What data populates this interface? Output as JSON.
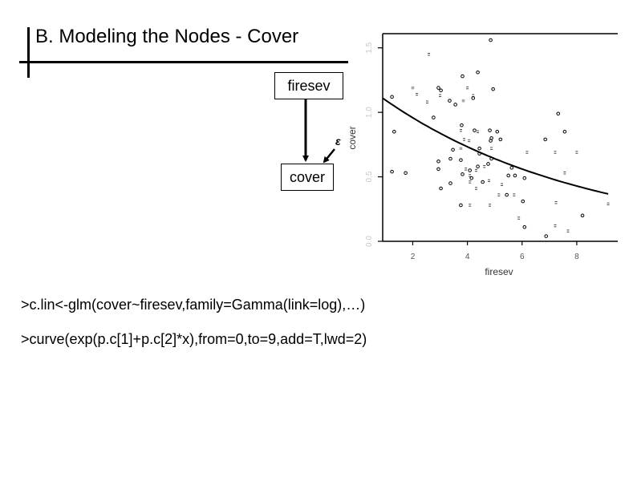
{
  "slide": {
    "title": "B. Modeling the Nodes - Cover",
    "diagram": {
      "parent_node": "firesev",
      "child_node": "cover",
      "error_label": "ε"
    },
    "code_lines": [
      ">c.lin<-glm(cover~firesev,family=Gamma(link=log),…)",
      ">curve(exp(p.c[1]+p.c[2]*x),from=0,to=9,add=T,lwd=2)"
    ]
  },
  "chart_data": {
    "type": "scatter",
    "title": "",
    "xlabel": "firesev",
    "ylabel": "cover",
    "xlim": [
      0.9,
      9.5
    ],
    "ylim": [
      0.0,
      1.61
    ],
    "x_ticks": [
      2,
      4,
      6,
      8
    ],
    "x_tick_labels": [
      "2",
      "4",
      "6",
      "8"
    ],
    "y_ticks": [
      0.0,
      0.5,
      1.0,
      1.5
    ],
    "y_tick_labels": [
      "0.0",
      "0.5",
      "1.0",
      "1.5"
    ],
    "grid": false,
    "legend": "none",
    "points": [
      {
        "x": 4.85,
        "y": 1.56,
        "m": "o"
      },
      {
        "x": 1.24,
        "y": 1.12,
        "m": "o"
      },
      {
        "x": 1.32,
        "y": 0.85,
        "m": "o"
      },
      {
        "x": 1.24,
        "y": 0.54,
        "m": "o"
      },
      {
        "x": 1.74,
        "y": 0.53,
        "m": "o"
      },
      {
        "x": 2.59,
        "y": 1.45,
        "m": "="
      },
      {
        "x": 2.0,
        "y": 1.19,
        "m": "g"
      },
      {
        "x": 2.15,
        "y": 1.14,
        "m": "="
      },
      {
        "x": 2.53,
        "y": 1.08,
        "m": "="
      },
      {
        "x": 2.76,
        "y": 0.96,
        "m": "o"
      },
      {
        "x": 2.94,
        "y": 1.19,
        "m": "o"
      },
      {
        "x": 3.03,
        "y": 1.17,
        "m": "o"
      },
      {
        "x": 3.0,
        "y": 1.13,
        "m": "="
      },
      {
        "x": 3.35,
        "y": 1.09,
        "m": "o"
      },
      {
        "x": 3.56,
        "y": 1.06,
        "m": "o"
      },
      {
        "x": 3.82,
        "y": 1.28,
        "m": "o"
      },
      {
        "x": 4.38,
        "y": 1.31,
        "m": "o"
      },
      {
        "x": 4.0,
        "y": 1.19,
        "m": "="
      },
      {
        "x": 3.85,
        "y": 1.09,
        "m": "g"
      },
      {
        "x": 4.21,
        "y": 1.13,
        "m": "="
      },
      {
        "x": 4.21,
        "y": 1.11,
        "m": "o"
      },
      {
        "x": 4.94,
        "y": 1.18,
        "m": "o"
      },
      {
        "x": 3.79,
        "y": 0.9,
        "m": "o"
      },
      {
        "x": 3.76,
        "y": 0.86,
        "m": "="
      },
      {
        "x": 4.26,
        "y": 0.86,
        "m": "o"
      },
      {
        "x": 4.38,
        "y": 0.85,
        "m": "="
      },
      {
        "x": 4.82,
        "y": 0.86,
        "m": "o"
      },
      {
        "x": 5.09,
        "y": 0.85,
        "m": "o"
      },
      {
        "x": 4.85,
        "y": 0.78,
        "m": "o"
      },
      {
        "x": 5.21,
        "y": 0.79,
        "m": "o"
      },
      {
        "x": 6.85,
        "y": 0.79,
        "m": "o"
      },
      {
        "x": 7.56,
        "y": 0.85,
        "m": "o"
      },
      {
        "x": 7.32,
        "y": 0.99,
        "m": "o"
      },
      {
        "x": 3.88,
        "y": 0.79,
        "m": "="
      },
      {
        "x": 4.06,
        "y": 0.78,
        "m": "="
      },
      {
        "x": 3.47,
        "y": 0.71,
        "m": "o"
      },
      {
        "x": 3.38,
        "y": 0.64,
        "m": "o"
      },
      {
        "x": 3.76,
        "y": 0.72,
        "m": "g"
      },
      {
        "x": 2.94,
        "y": 0.62,
        "m": "o"
      },
      {
        "x": 3.76,
        "y": 0.63,
        "m": "o"
      },
      {
        "x": 4.44,
        "y": 0.72,
        "m": "o"
      },
      {
        "x": 4.88,
        "y": 0.8,
        "m": "o"
      },
      {
        "x": 4.44,
        "y": 0.68,
        "m": "o"
      },
      {
        "x": 4.88,
        "y": 0.64,
        "m": "o"
      },
      {
        "x": 4.88,
        "y": 0.72,
        "m": "="
      },
      {
        "x": 4.76,
        "y": 0.6,
        "m": "o"
      },
      {
        "x": 2.94,
        "y": 0.56,
        "m": "o"
      },
      {
        "x": 3.94,
        "y": 0.56,
        "m": "="
      },
      {
        "x": 4.09,
        "y": 0.55,
        "m": "o"
      },
      {
        "x": 4.32,
        "y": 0.55,
        "m": "="
      },
      {
        "x": 4.38,
        "y": 0.58,
        "m": "o"
      },
      {
        "x": 4.62,
        "y": 0.58,
        "m": "="
      },
      {
        "x": 3.82,
        "y": 0.52,
        "m": "o"
      },
      {
        "x": 4.09,
        "y": 0.51,
        "m": "="
      },
      {
        "x": 4.15,
        "y": 0.49,
        "m": "o"
      },
      {
        "x": 4.56,
        "y": 0.46,
        "m": "o"
      },
      {
        "x": 3.38,
        "y": 0.45,
        "m": "o"
      },
      {
        "x": 3.03,
        "y": 0.41,
        "m": "o"
      },
      {
        "x": 4.09,
        "y": 0.46,
        "m": "="
      },
      {
        "x": 4.32,
        "y": 0.41,
        "m": "="
      },
      {
        "x": 4.79,
        "y": 0.47,
        "m": "="
      },
      {
        "x": 5.15,
        "y": 0.36,
        "m": "="
      },
      {
        "x": 5.5,
        "y": 0.51,
        "m": "o"
      },
      {
        "x": 5.62,
        "y": 0.57,
        "m": "o"
      },
      {
        "x": 6.18,
        "y": 0.69,
        "m": "="
      },
      {
        "x": 7.21,
        "y": 0.69,
        "m": "="
      },
      {
        "x": 8.0,
        "y": 0.69,
        "m": "="
      },
      {
        "x": 6.09,
        "y": 0.49,
        "m": "o"
      },
      {
        "x": 7.56,
        "y": 0.53,
        "m": "="
      },
      {
        "x": 5.74,
        "y": 0.51,
        "m": "o"
      },
      {
        "x": 5.71,
        "y": 0.36,
        "m": "="
      },
      {
        "x": 5.44,
        "y": 0.36,
        "m": "o"
      },
      {
        "x": 5.26,
        "y": 0.44,
        "m": "="
      },
      {
        "x": 4.09,
        "y": 0.28,
        "m": "="
      },
      {
        "x": 3.76,
        "y": 0.28,
        "m": "o"
      },
      {
        "x": 4.82,
        "y": 0.28,
        "m": "="
      },
      {
        "x": 6.03,
        "y": 0.31,
        "m": "o"
      },
      {
        "x": 5.88,
        "y": 0.18,
        "m": "="
      },
      {
        "x": 7.24,
        "y": 0.3,
        "m": "="
      },
      {
        "x": 8.21,
        "y": 0.2,
        "m": "o"
      },
      {
        "x": 9.15,
        "y": 0.29,
        "m": "="
      },
      {
        "x": 6.09,
        "y": 0.11,
        "m": "o"
      },
      {
        "x": 7.21,
        "y": 0.12,
        "m": "="
      },
      {
        "x": 7.68,
        "y": 0.08,
        "m": "="
      },
      {
        "x": 6.88,
        "y": 0.04,
        "m": "o"
      }
    ],
    "fitted_curve": {
      "formula": "exp(a + b*x)",
      "a": 0.225,
      "b": -0.134,
      "from": 0.9,
      "to": 9.15
    }
  }
}
